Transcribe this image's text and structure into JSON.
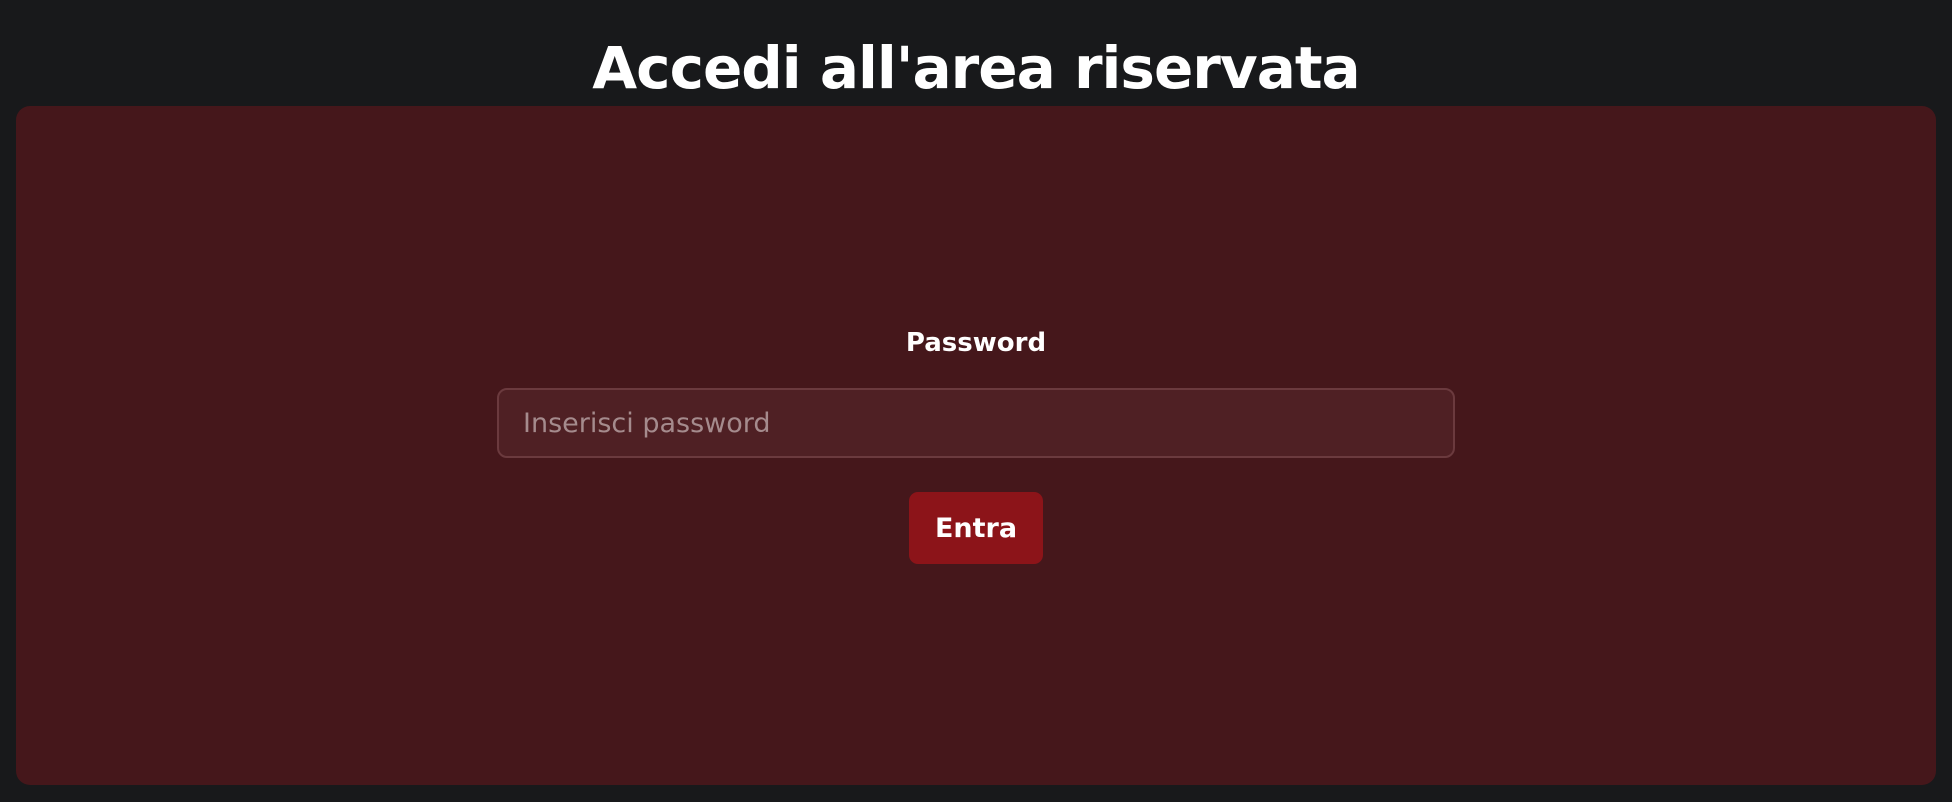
{
  "page": {
    "title": "Accedi all'area riservata"
  },
  "login": {
    "password_label": "Password",
    "password_placeholder": "Inserisci password",
    "password_value": "",
    "submit_label": "Entra"
  },
  "colors": {
    "page_background": "#18191b",
    "panel_background": "#45171b",
    "input_background": "#4f2024",
    "input_border": "#6b3a3e",
    "button_background": "#8c1419",
    "text": "#ffffff",
    "placeholder": "#a58b8d"
  }
}
